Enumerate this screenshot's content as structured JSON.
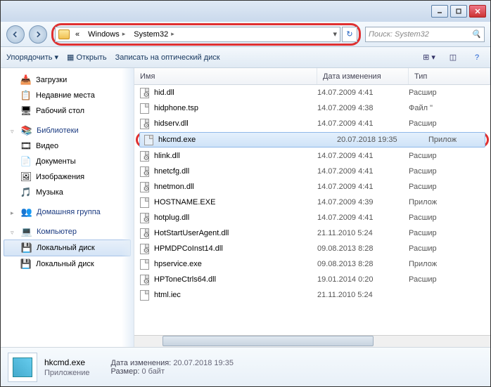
{
  "breadcrumb": {
    "prefix": "«",
    "p1": "Windows",
    "p2": "System32"
  },
  "search": {
    "placeholder": "Поиск: System32"
  },
  "toolbar": {
    "organize": "Упорядочить ▾",
    "open": "Открыть",
    "burn": "Записать на оптический диск"
  },
  "columns": {
    "name": "Имя",
    "date": "Дата изменения",
    "type": "Тип"
  },
  "sidebar": {
    "fav": {
      "downloads": "Загрузки",
      "recent": "Недавние места",
      "desktop": "Рабочий стол"
    },
    "libs": {
      "header": "Библиотеки",
      "video": "Видео",
      "docs": "Документы",
      "pics": "Изображения",
      "music": "Музыка"
    },
    "homegroup": "Домашняя группа",
    "computer": {
      "header": "Компьютер",
      "local1": "Локальный диск",
      "local2": "Локальный диск"
    }
  },
  "files": [
    {
      "name": "hid.dll",
      "date": "14.07.2009 4:41",
      "type": "Расшир"
    },
    {
      "name": "hidphone.tsp",
      "date": "14.07.2009 4:38",
      "type": "Файл \""
    },
    {
      "name": "hidserv.dll",
      "date": "14.07.2009 4:41",
      "type": "Расшир"
    },
    {
      "name": "hkcmd.exe",
      "date": "20.07.2018 19:35",
      "type": "Прилож"
    },
    {
      "name": "hlink.dll",
      "date": "14.07.2009 4:41",
      "type": "Расшир"
    },
    {
      "name": "hnetcfg.dll",
      "date": "14.07.2009 4:41",
      "type": "Расшир"
    },
    {
      "name": "hnetmon.dll",
      "date": "14.07.2009 4:41",
      "type": "Расшир"
    },
    {
      "name": "HOSTNAME.EXE",
      "date": "14.07.2009 4:39",
      "type": "Прилож"
    },
    {
      "name": "hotplug.dll",
      "date": "14.07.2009 4:41",
      "type": "Расшир"
    },
    {
      "name": "HotStartUserAgent.dll",
      "date": "21.11.2010 5:24",
      "type": "Расшир"
    },
    {
      "name": "HPMDPCoInst14.dll",
      "date": "09.08.2013 8:28",
      "type": "Расшир"
    },
    {
      "name": "hpservice.exe",
      "date": "09.08.2013 8:28",
      "type": "Прилож"
    },
    {
      "name": "HPToneCtrls64.dll",
      "date": "19.01.2014 0:20",
      "type": "Расшир"
    },
    {
      "name": "html.iec",
      "date": "21.11.2010 5:24",
      "type": ""
    }
  ],
  "details": {
    "name": "hkcmd.exe",
    "type": "Приложение",
    "date_label": "Дата изменения:",
    "date": "20.07.2018 19:35",
    "size_label": "Размер:",
    "size": "0 байт"
  }
}
